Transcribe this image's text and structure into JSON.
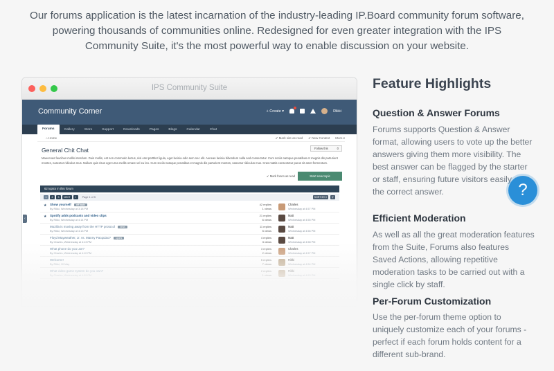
{
  "intro": "Our forums application is the latest incarnation of the industry-leading IP.Board community forum software, powering thousands of communities online. Redesigned for even greater integration with the IPS Community Suite, it's the most powerful way to enable discussion on your website.",
  "browser": {
    "title": "IPS Community Suite",
    "site_name": "Community Corner",
    "header": {
      "create": "Create",
      "user": "Rikki"
    },
    "nav": [
      "Forums",
      "Gallery",
      "Store",
      "Support",
      "Downloads",
      "Pages",
      "Blogs",
      "Calendar",
      "Chat"
    ],
    "breadcrumb": "Home",
    "crumb_actions": [
      "Mark site as read",
      "New Content",
      "More"
    ],
    "forum_title": "General Chit Chat",
    "follow_label": "Follow this",
    "follow_count": "0",
    "forum_desc": "Maecenas faucibus mollis interdum. Duis mollis, est non commodo luctus, nisi erat porttitor ligula, eget lacinia odio sem nec elit. Aenean lacinia bibendum nulla sed consectetur. Cum sociis natoque penatibus et magnis dis parturient montes, nascetur ridiculus mus. Nullam quis risus eget urna mollis ornare vel eu leo. Cum sociis natoque penatibus et magnis dis parturient montes, nascetur ridiculus mus. Cras mattis consectetur purus sit amet fermentum.",
    "mark_read": "Mark forum as read",
    "start_topic": "Start new topic",
    "list_head": "62 topics in this forum",
    "pager": [
      "1",
      "2",
      "3",
      "NEXT",
      "»"
    ],
    "page_of": "Page 1 of 5",
    "sort_label": "SORT BY",
    "topics": [
      {
        "title": "Show yourself",
        "meta": "By Rikki, Wednesday at 3:18 PM",
        "tag": "off topic",
        "replies": "42 replies",
        "views": "1 views",
        "lp_name": "Charles",
        "lp_date": "Wednesday at 4:57 PM",
        "avatar": "#c89a76",
        "read": false
      },
      {
        "title": "Spotify adds podcasts and video clips",
        "meta": "By Rikki, Wednesday at 4:14 PM",
        "tag": "",
        "replies": "21 replies",
        "views": "6 views",
        "lp_name": "Matt",
        "lp_date": "Wednesday at 4:55 PM",
        "avatar": "#5a4a42",
        "read": false
      },
      {
        "title": "Mozilla is moving away from the HTTP protocol",
        "meta": "By Rikki, Wednesday at 4:13 PM",
        "tag": "news",
        "replies": "11 replies",
        "views": "5 views",
        "lp_name": "Matt",
        "lp_date": "Wednesday at 4:56 PM",
        "avatar": "#5a4a42",
        "read": true
      },
      {
        "title": "Floyd Mayweather, Jr. vs. Manny Pacquiao?",
        "meta": "By Charles, Wednesday at 4:13 PM",
        "tag": "sports",
        "replies": "4 replies",
        "views": "3 views",
        "lp_name": "Matt",
        "lp_date": "Wednesday at 4:58 PM",
        "avatar": "#5a4a42",
        "read": true
      },
      {
        "title": "What phone do you use?",
        "meta": "By Charles, Wednesday at 4:10 PM",
        "tag": "",
        "replies": "3 replies",
        "views": "2 views",
        "lp_name": "Charles",
        "lp_date": "Wednesday at 4:57 PM",
        "avatar": "#c89a76",
        "read": true
      },
      {
        "title": "Welcome!",
        "meta": "By Rikki, 10 May",
        "tag": "",
        "replies": "5 replies",
        "views": "7 views",
        "lp_name": "Rikki",
        "lp_date": "Wednesday at 4:54 PM",
        "avatar": "#b8a080",
        "read": true
      },
      {
        "title": "What video game system do you own?",
        "meta": "By Charles, Wednesday at 4:09 PM",
        "tag": "",
        "replies": "2 replies",
        "views": "1 views",
        "lp_name": "Rikki",
        "lp_date": "Wednesday at 4:53 PM",
        "avatar": "#b8a080",
        "read": true
      }
    ]
  },
  "features": {
    "title": "Feature Highlights",
    "items": [
      {
        "head": "Question & Answer Forums",
        "body": "Forums supports Question & Answer format, allowing users to vote up the better answers giving them more visibility. The best answer can be flagged by the starter or staff, ensuring future visitors easily see the correct answer."
      },
      {
        "head": "Efficient Moderation",
        "body": "As well as all the great moderation features from the Suite, Forums also features Saved Actions, allowing repetitive moderation tasks to be carried out with a single click by staff."
      },
      {
        "head": "Per-Forum Customization",
        "body": "Use the per-forum theme option to uniquely customize each of your forums - perfect if each forum holds content for a different sub-brand."
      }
    ]
  },
  "help_icon": "?",
  "colors": {
    "header": "#3f5a77",
    "nav": "#2c3e50",
    "accent_button": "#4a8a71",
    "help": "#2a8fd8"
  }
}
